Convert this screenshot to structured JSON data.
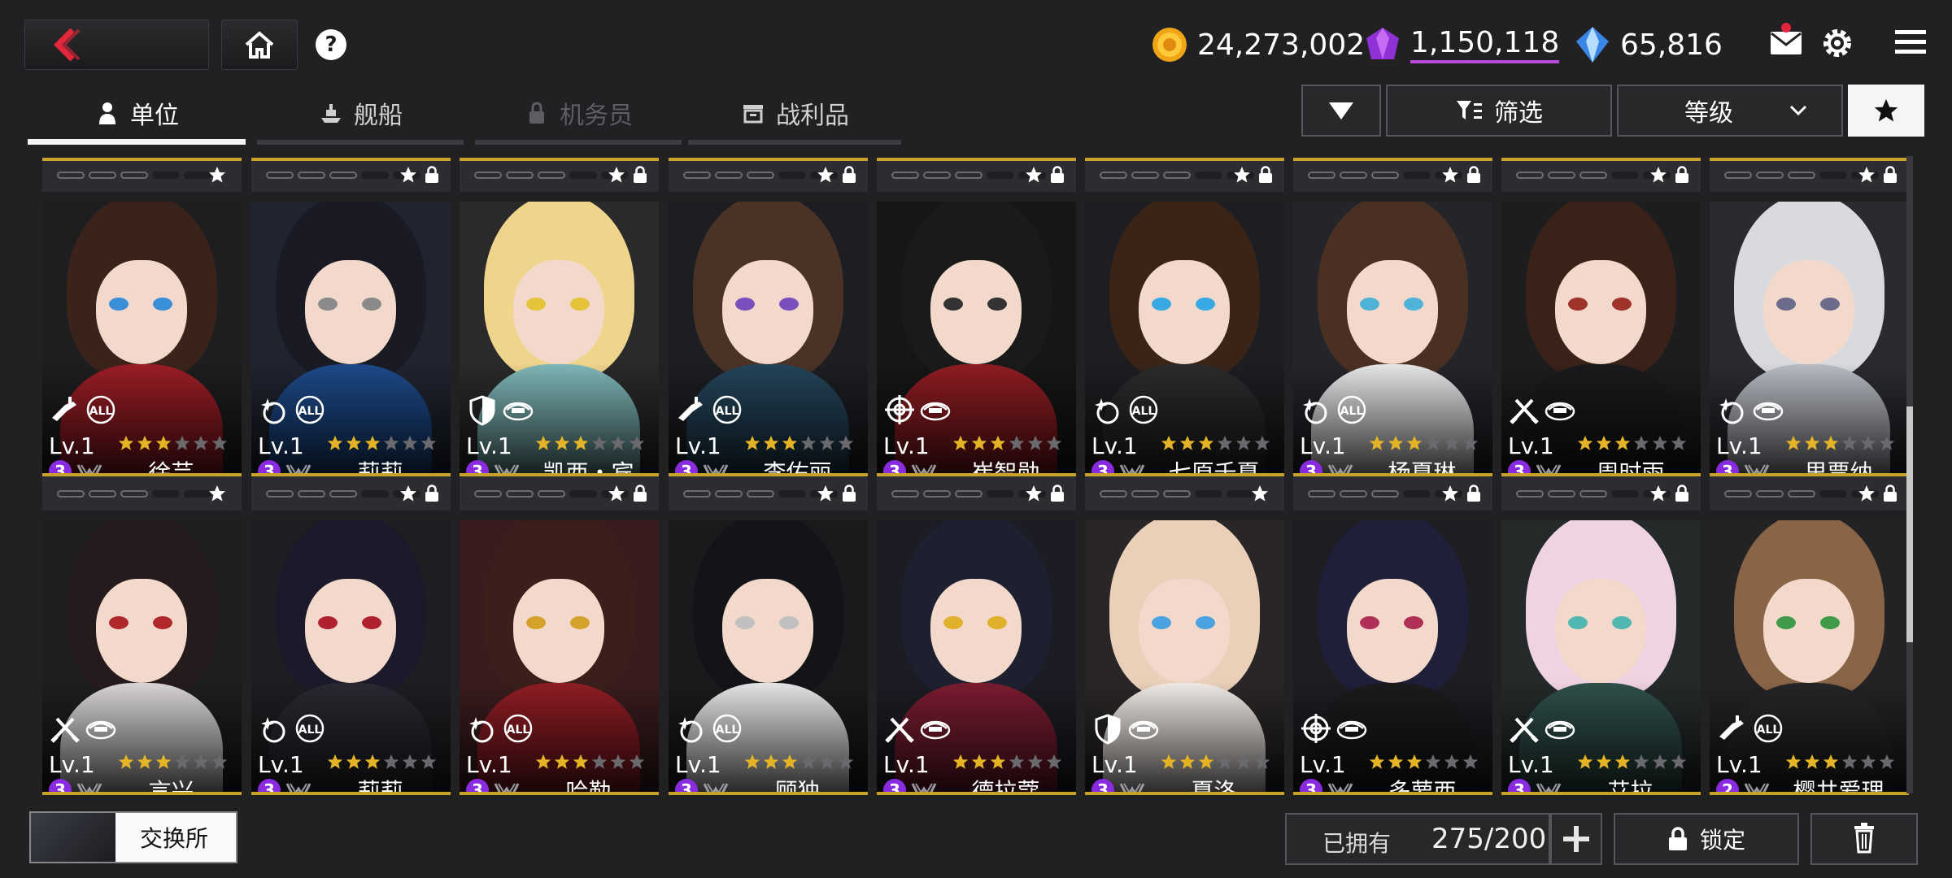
{
  "currencies": {
    "gold": "24,273,002",
    "purple_gem": "1,150,118",
    "crystal": "65,816"
  },
  "tabs": [
    {
      "label": "单位",
      "icon": "person-icon",
      "state": "active"
    },
    {
      "label": "舰船",
      "icon": "ship-icon",
      "state": "normal"
    },
    {
      "label": "机务员",
      "icon": "lock-icon",
      "state": "disabled"
    },
    {
      "label": "战利品",
      "icon": "crate-icon",
      "state": "normal"
    }
  ],
  "filters": {
    "filter_label": "筛选",
    "sort_label": "等级"
  },
  "colors": {
    "gold": "#c9a22a",
    "rank_purple": "#8a2be2",
    "star_gold": "#e5b326",
    "background": "#212124"
  },
  "units": [
    {
      "name": "徐芸",
      "level": "Lv.1",
      "rank": "3",
      "stars": 3,
      "role": "rifle",
      "target": "all",
      "lock": false,
      "hair": "#3a231a",
      "eyes": "#3a8fd8",
      "outfit": "#9b1d26",
      "bg": "#1e1e21"
    },
    {
      "name": "莉莉",
      "level": "Lv.1",
      "rank": "3",
      "stars": 3,
      "role": "sparkle",
      "target": "all",
      "lock": true,
      "hair": "#1a1a24",
      "eyes": "#8a8a8a",
      "outfit": "#1d4a8a",
      "bg": "#1f2430"
    },
    {
      "name": "凯西・宾",
      "level": "Lv.1",
      "rank": "3",
      "stars": 3,
      "role": "shield",
      "target": "ground",
      "lock": true,
      "hair": "#efd58c",
      "eyes": "#e5c43a",
      "outfit": "#7fb7b8",
      "bg": "#2b2a2a"
    },
    {
      "name": "李佑丽",
      "level": "Lv.1",
      "rank": "3",
      "stars": 3,
      "role": "rifle",
      "target": "all",
      "lock": true,
      "hair": "#4a3326",
      "eyes": "#7b4ec0",
      "outfit": "#24445a",
      "bg": "#1c1e22"
    },
    {
      "name": "崔智勋",
      "level": "Lv.1",
      "rank": "3",
      "stars": 3,
      "role": "crosshair",
      "target": "ground",
      "lock": true,
      "hair": "#1a1a1a",
      "eyes": "#333",
      "outfit": "#8f1c22",
      "bg": "#161617"
    },
    {
      "name": "七原千夏",
      "level": "Lv.1",
      "rank": "3",
      "stars": 3,
      "role": "sparkle",
      "target": "all",
      "lock": true,
      "hair": "#3a2418",
      "eyes": "#38a9e3",
      "outfit": "#2b2b2e",
      "bg": "#1e1e22"
    },
    {
      "name": "杨夏琳",
      "level": "Lv.1",
      "rank": "3",
      "stars": 3,
      "role": "sparkle",
      "target": "all",
      "lock": true,
      "hair": "#4a3022",
      "eyes": "#4fb3d9",
      "outfit": "#e8e8ea",
      "bg": "#23252a"
    },
    {
      "name": "周时雨",
      "level": "Lv.1",
      "rank": "3",
      "stars": 3,
      "role": "swords",
      "target": "ground",
      "lock": true,
      "hair": "#3a2219",
      "eyes": "#a0332a",
      "outfit": "#1b1b1d",
      "bg": "#1d1d20"
    },
    {
      "name": "里贾纳",
      "level": "Lv.1",
      "rank": "3",
      "stars": 3,
      "role": "sparkle",
      "target": "ground",
      "lock": true,
      "hair": "#d9dadf",
      "eyes": "#6b6b8c",
      "outfit": "#b9bcc4",
      "bg": "#2a2b30"
    },
    {
      "name": "言兴",
      "level": "Lv.1",
      "rank": "3",
      "stars": 3,
      "role": "swords",
      "target": "ground",
      "lock": false,
      "hair": "#251a1c",
      "eyes": "#b0282c",
      "outfit": "#d9d6d6",
      "bg": "#1e1d20"
    },
    {
      "name": "莉莉",
      "level": "Lv.1",
      "rank": "3",
      "stars": 3,
      "role": "sparkle",
      "target": "all",
      "lock": true,
      "hair": "#1c1a2a",
      "eyes": "#b02030",
      "outfit": "#2a2830",
      "bg": "#1e1e22"
    },
    {
      "name": "哈勒",
      "level": "Lv.1",
      "rank": "3",
      "stars": 3,
      "role": "sparkle",
      "target": "all",
      "lock": true,
      "hair": "#3a1f1a",
      "eyes": "#d4a12a",
      "outfit": "#8f1d24",
      "bg": "#3a1c1e"
    },
    {
      "name": "顾独",
      "level": "Lv.1",
      "rank": "3",
      "stars": 3,
      "role": "sparkle",
      "target": "all",
      "lock": true,
      "hair": "#141418",
      "eyes": "#c0c0c0",
      "outfit": "#e6e6e8",
      "bg": "#1a1a1d"
    },
    {
      "name": "德拉蔻",
      "level": "Lv.1",
      "rank": "3",
      "stars": 3,
      "role": "swords",
      "target": "ground",
      "lock": true,
      "hair": "#1e2030",
      "eyes": "#e0b02a",
      "outfit": "#7a1c30",
      "bg": "#1c1d24"
    },
    {
      "name": "夏洛",
      "level": "Lv.1",
      "rank": "3",
      "stars": 3,
      "role": "shield",
      "target": "ground",
      "lock": false,
      "hair": "#ead0b8",
      "eyes": "#4aa3e0",
      "outfit": "#f2ece8",
      "bg": "#2a2628"
    },
    {
      "name": "多萝西",
      "level": "Lv.1",
      "rank": "3",
      "stars": 3,
      "role": "crosshair",
      "target": "ground",
      "lock": true,
      "hair": "#1f1f3a",
      "eyes": "#b03058",
      "outfit": "#1b1b1e",
      "bg": "#1d1d22"
    },
    {
      "name": "艾拉",
      "level": "Lv.1",
      "rank": "3",
      "stars": 3,
      "role": "swords",
      "target": "ground",
      "lock": true,
      "hair": "#f0d3e3",
      "eyes": "#52b7b0",
      "outfit": "#2f4f4a",
      "bg": "#242a2a"
    },
    {
      "name": "樱井爱理",
      "level": "Lv.1",
      "rank": "2",
      "stars": 3,
      "role": "rifle",
      "target": "all",
      "lock": true,
      "hair": "#8a6446",
      "eyes": "#3f9a4a",
      "outfit": "#262628",
      "bg": "#232326"
    }
  ],
  "bottom": {
    "exchange_label": "交换所",
    "owned_label": "已拥有",
    "owned_value": "275/200",
    "lock_label": "锁定"
  }
}
